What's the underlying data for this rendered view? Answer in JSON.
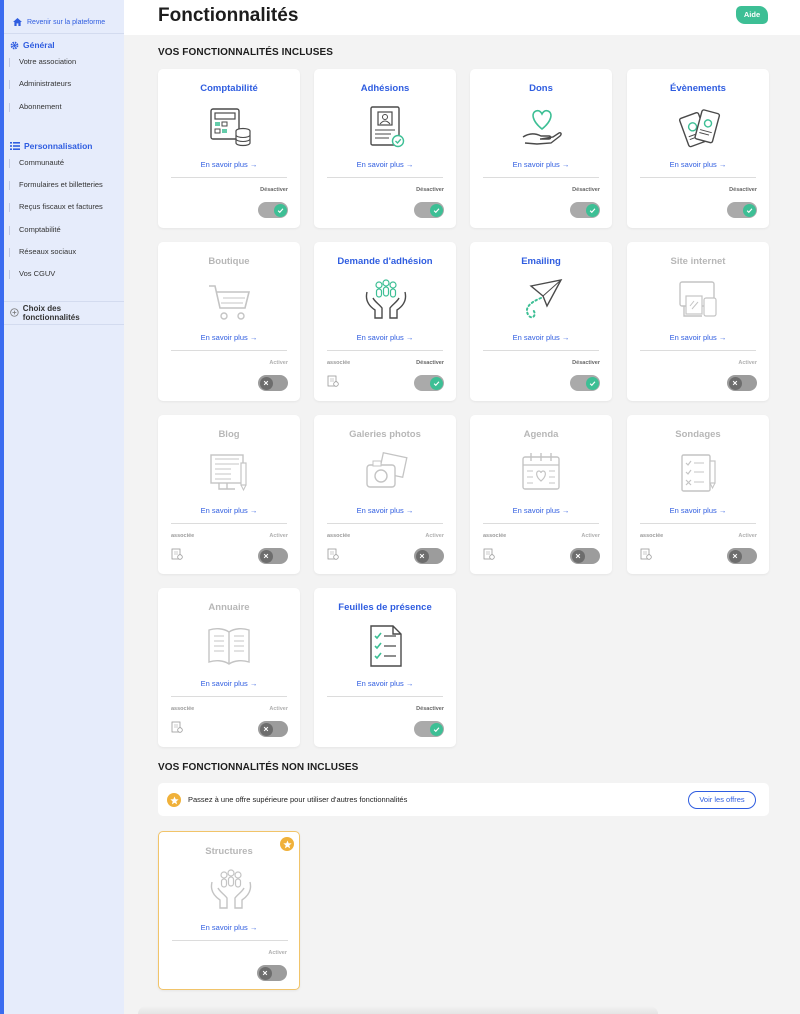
{
  "sidebar": {
    "back_label": "Revenir sur la plateforme",
    "sections": [
      {
        "title": "Général",
        "items": [
          "Votre association",
          "Administrateurs",
          "Abonnement"
        ]
      },
      {
        "title": "Personnalisation",
        "items": [
          "Communauté",
          "Formulaires et billetteries",
          "Reçus fiscaux et factures",
          "Comptabilité",
          "Réseaux sociaux",
          "Vos CGUV"
        ]
      }
    ],
    "choix_label": "Choix des fonctionnalités"
  },
  "header": {
    "title": "Fonctionnalités",
    "help_label": "Aide"
  },
  "included_title": "VOS FONCTIONNALITÉS INCLUSES",
  "not_included_title": "VOS FONCTIONNALITÉS NON INCLUSES",
  "link_label": "En savoir plus →",
  "assoc_label": "associée",
  "features": [
    {
      "title": "Comptabilité",
      "enabled": true,
      "action": "Désactiver",
      "icon": "accounting-icon"
    },
    {
      "title": "Adhésions",
      "enabled": true,
      "action": "Désactiver",
      "icon": "membership-card-icon"
    },
    {
      "title": "Dons",
      "enabled": true,
      "action": "Désactiver",
      "icon": "donation-heart-hand-icon"
    },
    {
      "title": "Évènements",
      "enabled": true,
      "action": "Désactiver",
      "icon": "tickets-icon"
    },
    {
      "title": "Boutique",
      "enabled": false,
      "action": "Activer",
      "icon": "shopping-cart-icon"
    },
    {
      "title": "Demande d'adhésion",
      "enabled": true,
      "action": "Désactiver",
      "icon": "people-hands-icon",
      "associated": true
    },
    {
      "title": "Emailing",
      "enabled": true,
      "action": "Désactiver",
      "icon": "paper-plane-icon"
    },
    {
      "title": "Site internet",
      "enabled": false,
      "action": "Activer",
      "icon": "devices-icon"
    },
    {
      "title": "Blog",
      "enabled": false,
      "action": "Activer",
      "icon": "blog-icon",
      "associated": true
    },
    {
      "title": "Galeries photos",
      "enabled": false,
      "action": "Activer",
      "icon": "photo-gallery-icon",
      "associated": true
    },
    {
      "title": "Agenda",
      "enabled": false,
      "action": "Activer",
      "icon": "calendar-icon",
      "associated": true
    },
    {
      "title": "Sondages",
      "enabled": false,
      "action": "Activer",
      "icon": "survey-icon",
      "associated": true
    },
    {
      "title": "Annuaire",
      "enabled": false,
      "action": "Activer",
      "icon": "directory-book-icon",
      "associated": true
    },
    {
      "title": "Feuilles de présence",
      "enabled": true,
      "action": "Désactiver",
      "icon": "attendance-sheet-icon"
    }
  ],
  "banner": {
    "text": "Passez à une offre supérieure pour utiliser d'autres fonctionnalités",
    "button_label": "Voir les offres"
  },
  "premium_features": [
    {
      "title": "Structures",
      "enabled": false,
      "action": "Activer",
      "icon": "structures-icon"
    }
  ],
  "colors": {
    "accent": "#2f5de0",
    "success": "#3dbf95",
    "premium": "#f0b13a",
    "disabled": "#b7b7b7"
  }
}
